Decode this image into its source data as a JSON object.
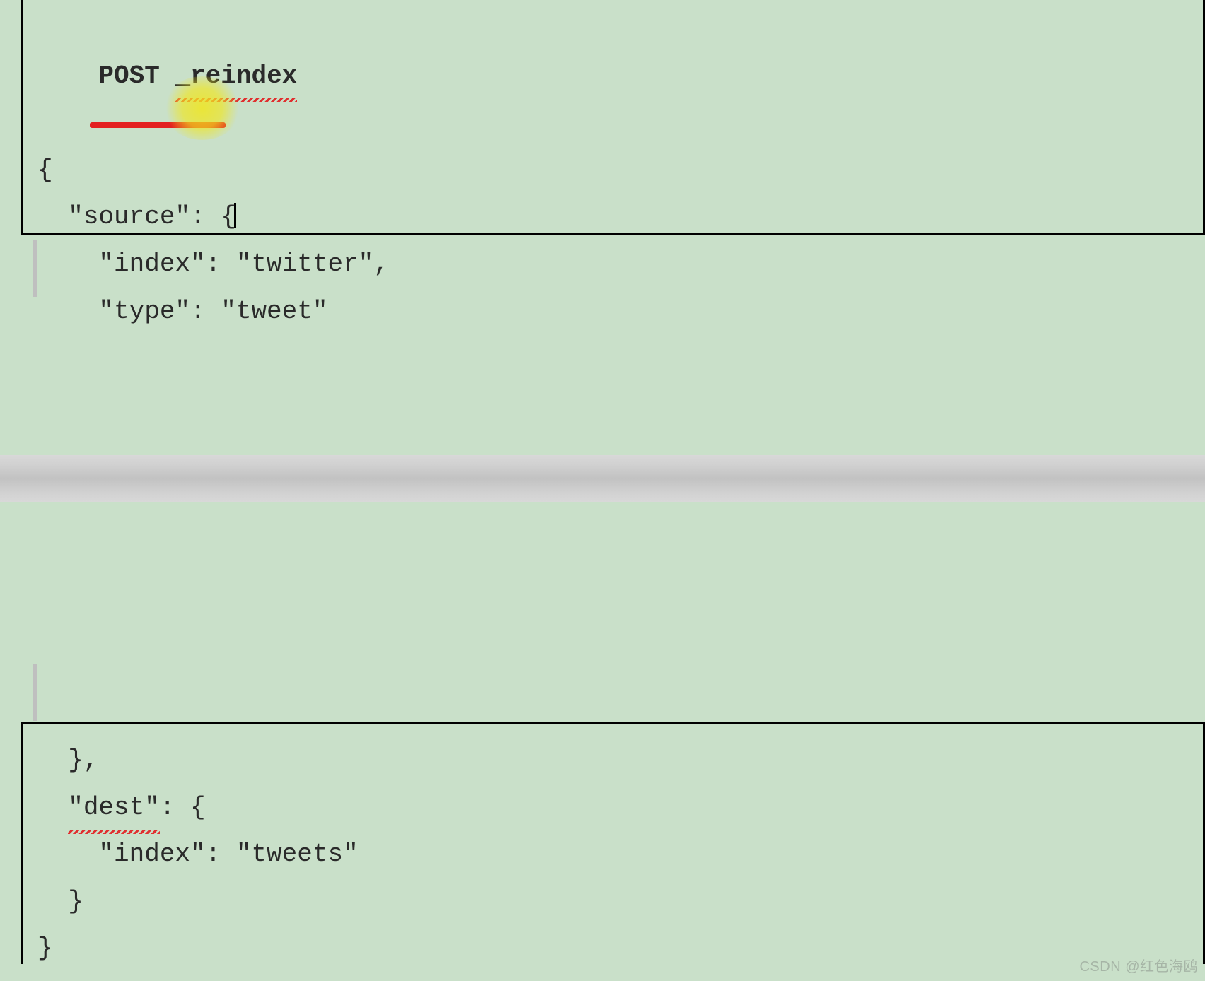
{
  "editor": {
    "top_block": {
      "line1_method": "POST",
      "line1_endpoint": "_reindex",
      "line2": "{",
      "line3_key": "\"source\"",
      "line3_colon_brace": ": {",
      "line4": "    \"index\": \"twitter\",",
      "line5": "    \"type\": \"tweet\""
    },
    "bottom_block": {
      "line1": "  },",
      "line2_key": "\"dest\"",
      "line2_rest": ": {",
      "line3": "    \"index\": \"tweets\"",
      "line4": "  }",
      "line5": "}"
    }
  },
  "watermark": "CSDN @红色海鸥"
}
